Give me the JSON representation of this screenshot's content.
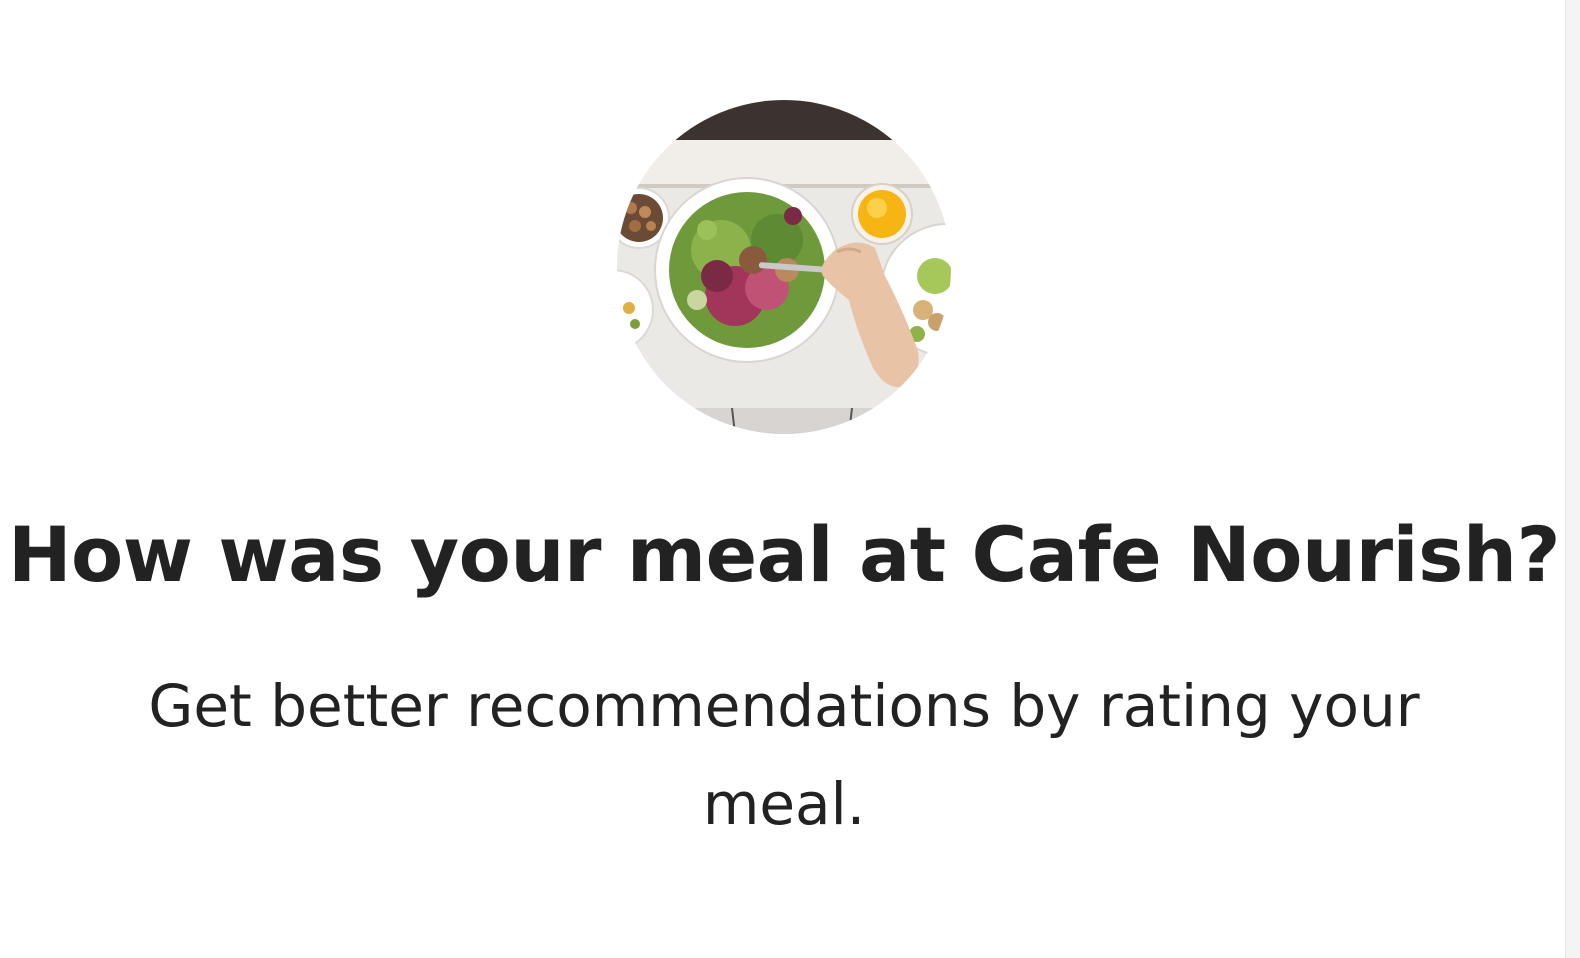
{
  "prompt": {
    "title": "How was your meal at Cafe Nourish?",
    "subtitle": "Get better recommendations by rating your meal."
  },
  "image": {
    "icon": "meal-photo",
    "alt": "Salad bowl"
  },
  "colors": {
    "background": "#ffffff",
    "text": "#222222"
  }
}
